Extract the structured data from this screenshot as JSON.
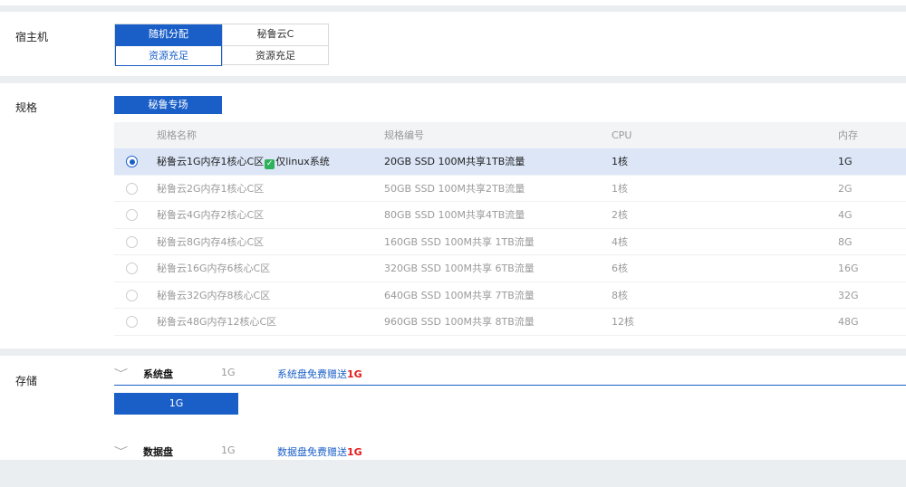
{
  "host": {
    "label": "宿主机",
    "options": [
      {
        "label": "随机分配",
        "status": "资源充足"
      },
      {
        "label": "秘鲁云C",
        "status": "资源充足"
      }
    ]
  },
  "spec": {
    "label": "规格",
    "tab": "秘鲁专场",
    "columns": [
      "规格名称",
      "规格编号",
      "CPU",
      "内存"
    ],
    "rows": [
      {
        "name": "秘鲁云1G内存1核心C区",
        "tag": "仅linux系统",
        "code": "20GB SSD 100M共享1TB流量",
        "cpu": "1核",
        "mem": "1G"
      },
      {
        "name": "秘鲁云2G内存1核心C区",
        "code": "50GB SSD 100M共享2TB流量",
        "cpu": "1核",
        "mem": "2G"
      },
      {
        "name": "秘鲁云4G内存2核心C区",
        "code": "80GB SSD 100M共享4TB流量",
        "cpu": "2核",
        "mem": "4G"
      },
      {
        "name": "秘鲁云8G内存4核心C区",
        "code": "160GB SSD 100M共享 1TB流量",
        "cpu": "4核",
        "mem": "8G"
      },
      {
        "name": "秘鲁云16G内存6核心C区",
        "code": "320GB SSD 100M共享 6TB流量",
        "cpu": "6核",
        "mem": "16G"
      },
      {
        "name": "秘鲁云32G内存8核心C区",
        "code": "640GB SSD 100M共享 7TB流量",
        "cpu": "8核",
        "mem": "32G"
      },
      {
        "name": "秘鲁云48G内存12核心C区",
        "code": "960GB SSD 100M共享 8TB流量",
        "cpu": "12核",
        "mem": "48G"
      }
    ]
  },
  "storage": {
    "label": "存储",
    "system_disk": {
      "name": "系统盘",
      "size": "1G",
      "promo": "系统盘免费赠送",
      "gift": "1G",
      "button": "1G"
    },
    "data_disk": {
      "name": "数据盘",
      "size": "1G",
      "promo": "数据盘免费赠送",
      "gift": "1G"
    }
  },
  "colors": {
    "accent": "#1a5fc8",
    "gift": "#e31c1c",
    "check": "#2fb15a"
  }
}
